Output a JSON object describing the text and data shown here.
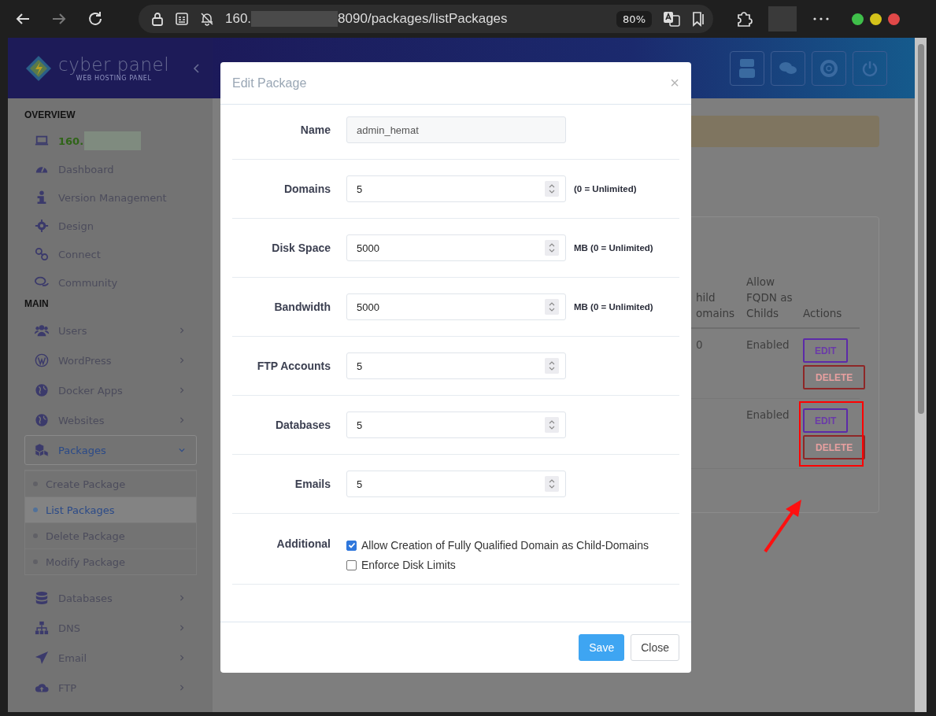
{
  "browser": {
    "url_host": "160.",
    "url_path": "8090/packages/listPackages",
    "zoom": "80%"
  },
  "header": {
    "logo_text": "cyber panel",
    "logo_tagline": "WEB HOSTING PANEL"
  },
  "sidebar": {
    "sections": [
      {
        "title": "OVERVIEW",
        "items": [
          {
            "kind": "server",
            "label": "160."
          },
          {
            "kind": "link",
            "label": "Dashboard"
          },
          {
            "kind": "link",
            "label": "Version Management"
          },
          {
            "kind": "link",
            "label": "Design"
          },
          {
            "kind": "link",
            "label": "Connect"
          },
          {
            "kind": "link",
            "label": "Community"
          }
        ]
      },
      {
        "title": "MAIN",
        "items": [
          {
            "kind": "menu",
            "label": "Users",
            "expanded": false
          },
          {
            "kind": "menu",
            "label": "WordPress",
            "expanded": false
          },
          {
            "kind": "menu",
            "label": "Docker Apps",
            "expanded": false
          },
          {
            "kind": "menu",
            "label": "Websites",
            "expanded": false
          },
          {
            "kind": "menu",
            "label": "Packages",
            "expanded": true,
            "children": [
              {
                "label": "Create Package",
                "selected": false
              },
              {
                "label": "List Packages",
                "selected": true
              },
              {
                "label": "Delete Package",
                "selected": false
              },
              {
                "label": "Modify Package",
                "selected": false
              }
            ]
          },
          {
            "kind": "menu",
            "label": "Databases",
            "expanded": false
          },
          {
            "kind": "menu",
            "label": "DNS",
            "expanded": false
          },
          {
            "kind": "menu",
            "label": "Email",
            "expanded": false
          },
          {
            "kind": "menu",
            "label": "FTP",
            "expanded": false
          }
        ]
      }
    ]
  },
  "table": {
    "columns": [
      "hild omains",
      "Allow FQDN as Childs",
      "Actions"
    ],
    "rows": [
      {
        "column_1": "0",
        "column_2": "Enabled",
        "actions": [
          "EDIT",
          "DELETE"
        ]
      },
      {
        "column_2": "Enabled",
        "actions": [
          "EDIT",
          "DELETE"
        ]
      }
    ]
  },
  "modal": {
    "title": "Edit Package",
    "close": "×",
    "fields": [
      {
        "label": "Name",
        "kind": "text",
        "value": "admin_hemat"
      },
      {
        "label": "Domains",
        "kind": "number",
        "value": "5",
        "suffix": "(0 = Unlimited)"
      },
      {
        "label": "Disk Space",
        "kind": "number",
        "value": "5000",
        "suffix": "MB (0 = Unlimited)"
      },
      {
        "label": "Bandwidth",
        "kind": "number",
        "value": "5000",
        "suffix": "MB (0 = Unlimited)"
      },
      {
        "label": "FTP Accounts",
        "kind": "number",
        "value": "5"
      },
      {
        "label": "Databases",
        "kind": "number",
        "value": "5"
      },
      {
        "label": "Emails",
        "kind": "number",
        "value": "5"
      }
    ],
    "additional": {
      "label": "Additional",
      "options": [
        {
          "label": "Allow Creation of Fully Qualified Domain as Child-Domains",
          "checked": true
        },
        {
          "label": "Enforce Disk Limits",
          "checked": false
        }
      ]
    },
    "buttons": [
      {
        "label": "Save",
        "kind": "primary"
      },
      {
        "label": "Close",
        "kind": "default"
      }
    ]
  }
}
